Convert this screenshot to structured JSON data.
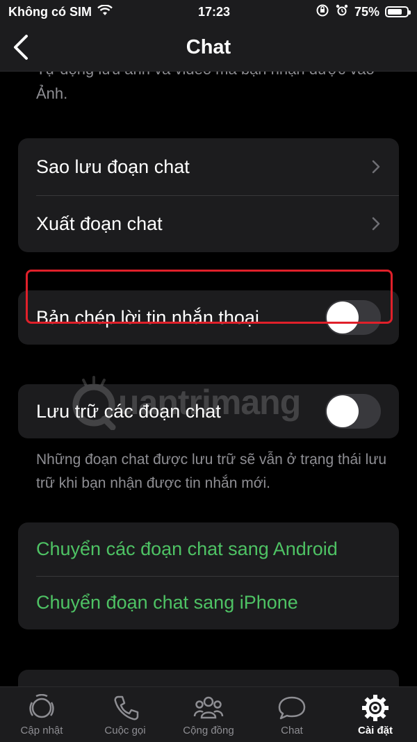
{
  "status": {
    "carrier": "Không có SIM",
    "time": "17:23",
    "battery": "75%",
    "battery_level": 0.75
  },
  "nav": {
    "title": "Chat"
  },
  "top_desc": "Tự động lưu ảnh và video mà bạn nhận được vào Ảnh.",
  "backup_card": {
    "backup_label": "Sao lưu đoạn chat",
    "export_label": "Xuất đoạn chat"
  },
  "voice_transcript": {
    "label": "Bản chép lời tin nhắn thoại",
    "enabled": false
  },
  "archive": {
    "label": "Lưu trữ các đoạn chat",
    "enabled": false,
    "note": "Những đoạn chat được lưu trữ sẽ vẫn ở trạng thái lưu trữ khi bạn nhận được tin nhắn mới."
  },
  "transfer": {
    "android_label": "Chuyển các đoạn chat sang Android",
    "iphone_label": "Chuyển đoạn chat sang iPhone"
  },
  "watermark": "uantrimang",
  "tabs": [
    {
      "label": "Cập nhật",
      "icon": "updates-icon",
      "active": false
    },
    {
      "label": "Cuộc gọi",
      "icon": "phone-icon",
      "active": false
    },
    {
      "label": "Cộng đồng",
      "icon": "community-icon",
      "active": false
    },
    {
      "label": "Chat",
      "icon": "chat-icon",
      "active": false
    },
    {
      "label": "Cài đặt",
      "icon": "settings-icon",
      "active": true
    }
  ],
  "colors": {
    "accent_green": "#4ec264",
    "highlight_red": "#e0202a",
    "background": "#000000",
    "card": "#1c1c1e"
  }
}
